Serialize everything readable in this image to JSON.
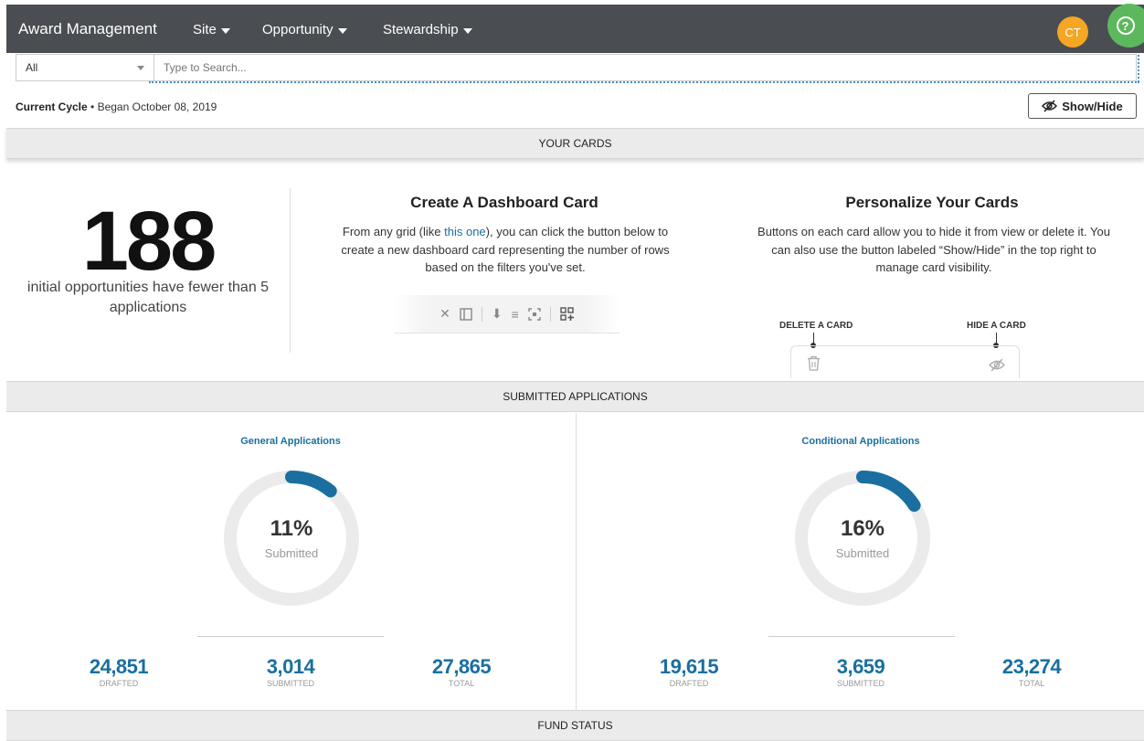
{
  "nav": {
    "brand": "Award Management",
    "items": [
      "Site",
      "Opportunity",
      "Stewardship"
    ],
    "avatar_initials": "CT",
    "help_icon": "?"
  },
  "search": {
    "scope": "All",
    "placeholder": "Type to Search..."
  },
  "cycle": {
    "label": "Current Cycle",
    "detail": " • Began October 08, 2019"
  },
  "showhide_label": "Show/Hide",
  "sections": {
    "your_cards": "YOUR CARDS",
    "submitted": "SUBMITTED APPLICATIONS",
    "fund_status": "FUND STATUS"
  },
  "metric_card": {
    "value": "188",
    "description": "initial opportunities have fewer than 5 applications"
  },
  "create_card": {
    "title": "Create A Dashboard Card",
    "text_before": "From any grid (like ",
    "link": "this one",
    "text_after": "), you can click the button below to create a new dashboard card representing the number of rows based on the filters you've set."
  },
  "personalize_card": {
    "title": "Personalize Your Cards",
    "text": "Buttons on each card allow you to hide it from view or delete it. You can also use the button labeled “Show/Hide” in the top right to manage card visibility.",
    "delete_label": "DELETE A CARD",
    "hide_label": "HIDE A CARD"
  },
  "applications": [
    {
      "title": "General Applications",
      "percent": "11%",
      "percent_value": 11,
      "percent_label": "Submitted",
      "drafted": "24,851",
      "submitted": "3,014",
      "total": "27,865"
    },
    {
      "title": "Conditional Applications",
      "percent": "16%",
      "percent_value": 16,
      "percent_label": "Submitted",
      "drafted": "19,615",
      "submitted": "3,659",
      "total": "23,274"
    }
  ],
  "stat_labels": {
    "drafted": "DRAFTED",
    "submitted": "SUBMITTED",
    "total": "TOTAL"
  },
  "colors": {
    "nav_bg": "#4a4d52",
    "accent": "#1a6fa0",
    "avatar": "#f5a623",
    "help": "#5cb85c",
    "donut_track": "#ebebeb"
  }
}
